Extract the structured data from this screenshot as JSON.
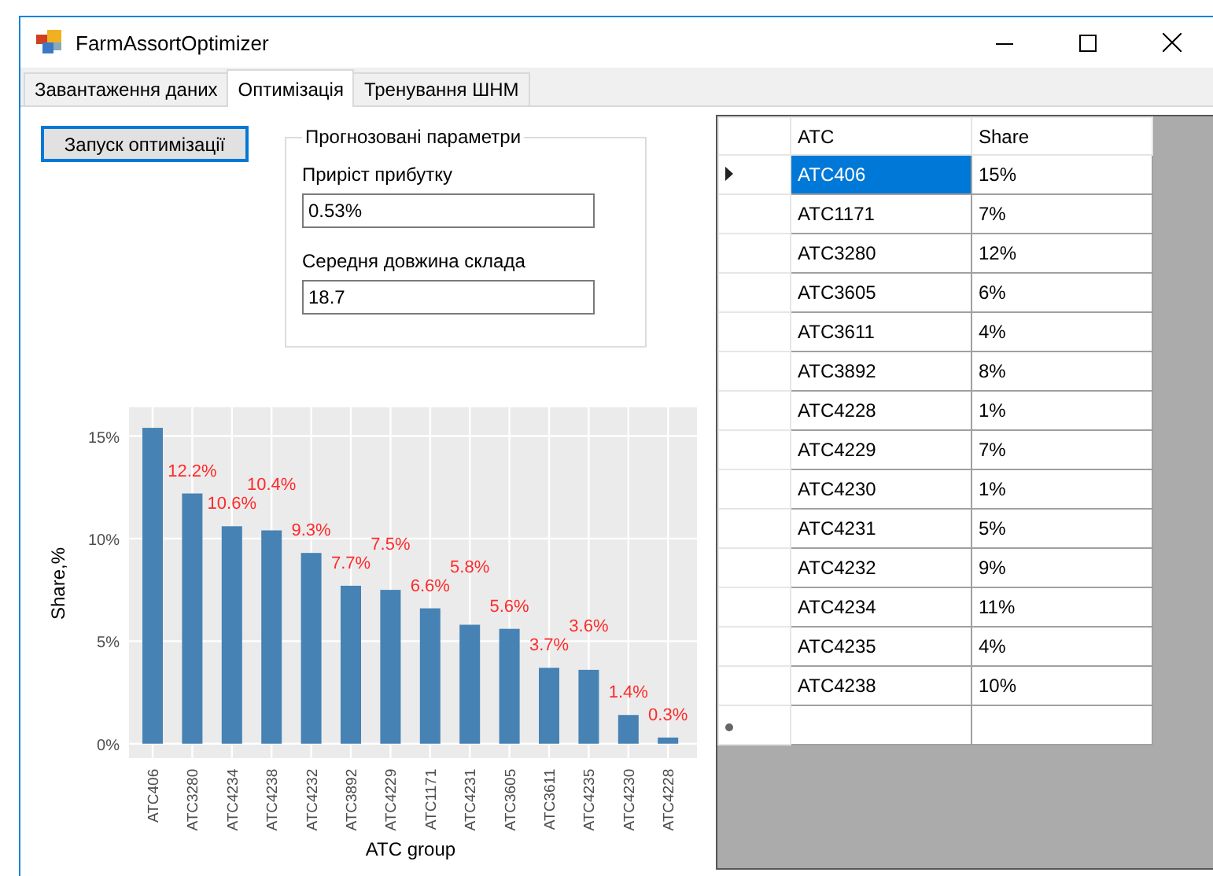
{
  "window": {
    "title": "FarmAssortOptimizer"
  },
  "tabs": [
    {
      "label": "Завантаження даних",
      "selected": false
    },
    {
      "label": "Оптимізація",
      "selected": true
    },
    {
      "label": "Тренування ШНМ",
      "selected": false
    }
  ],
  "run_button": "Запуск оптимізації",
  "forecast": {
    "title": "Прогнозовані параметри",
    "fields": [
      {
        "label": "Приріст прибутку",
        "value": "0.53%"
      },
      {
        "label": "Середня довжина склада",
        "value": "18.7"
      }
    ]
  },
  "chart_data": {
    "type": "bar",
    "xlabel": "ATC group",
    "ylabel": "Share,%",
    "categories": [
      "ATC406",
      "ATC3280",
      "ATC4234",
      "ATC4238",
      "ATC4232",
      "ATC3892",
      "ATC4229",
      "ATC1171",
      "ATC4231",
      "ATC3605",
      "ATC3611",
      "ATC4235",
      "ATC4230",
      "ATC4228"
    ],
    "values": [
      15.4,
      12.2,
      10.6,
      10.4,
      9.3,
      7.7,
      7.5,
      6.6,
      5.8,
      5.6,
      3.7,
      3.6,
      1.4,
      0.3
    ],
    "value_labels": [
      null,
      "12.2%",
      "10.6%",
      "10.4%",
      "9.3%",
      "7.7%",
      "7.5%",
      "6.6%",
      "5.8%",
      "5.6%",
      "3.7%",
      "3.6%",
      "1.4%",
      "0.3%"
    ],
    "ylim": [
      -0.7,
      16.4
    ],
    "grid": true,
    "yticks": [
      {
        "value": 0,
        "label": "0%"
      },
      {
        "value": 5,
        "label": "5%"
      },
      {
        "value": 10,
        "label": "10%"
      },
      {
        "value": 15,
        "label": "15%"
      }
    ]
  },
  "table": {
    "columns": [
      "ATC",
      "Share"
    ],
    "rows": [
      {
        "atc": "ATC406",
        "share": "15%",
        "selected": true
      },
      {
        "atc": "ATC1171",
        "share": "7%",
        "selected": false
      },
      {
        "atc": "ATC3280",
        "share": "12%",
        "selected": false
      },
      {
        "atc": "ATC3605",
        "share": "6%",
        "selected": false
      },
      {
        "atc": "ATC3611",
        "share": "4%",
        "selected": false
      },
      {
        "atc": "ATC3892",
        "share": "8%",
        "selected": false
      },
      {
        "atc": "ATC4228",
        "share": "1%",
        "selected": false
      },
      {
        "atc": "ATC4229",
        "share": "7%",
        "selected": false
      },
      {
        "atc": "ATC4230",
        "share": "1%",
        "selected": false
      },
      {
        "atc": "ATC4231",
        "share": "5%",
        "selected": false
      },
      {
        "atc": "ATC4232",
        "share": "9%",
        "selected": false
      },
      {
        "atc": "ATC4234",
        "share": "11%",
        "selected": false
      },
      {
        "atc": "ATC4235",
        "share": "4%",
        "selected": false
      },
      {
        "atc": "ATC4238",
        "share": "10%",
        "selected": false
      }
    ]
  }
}
